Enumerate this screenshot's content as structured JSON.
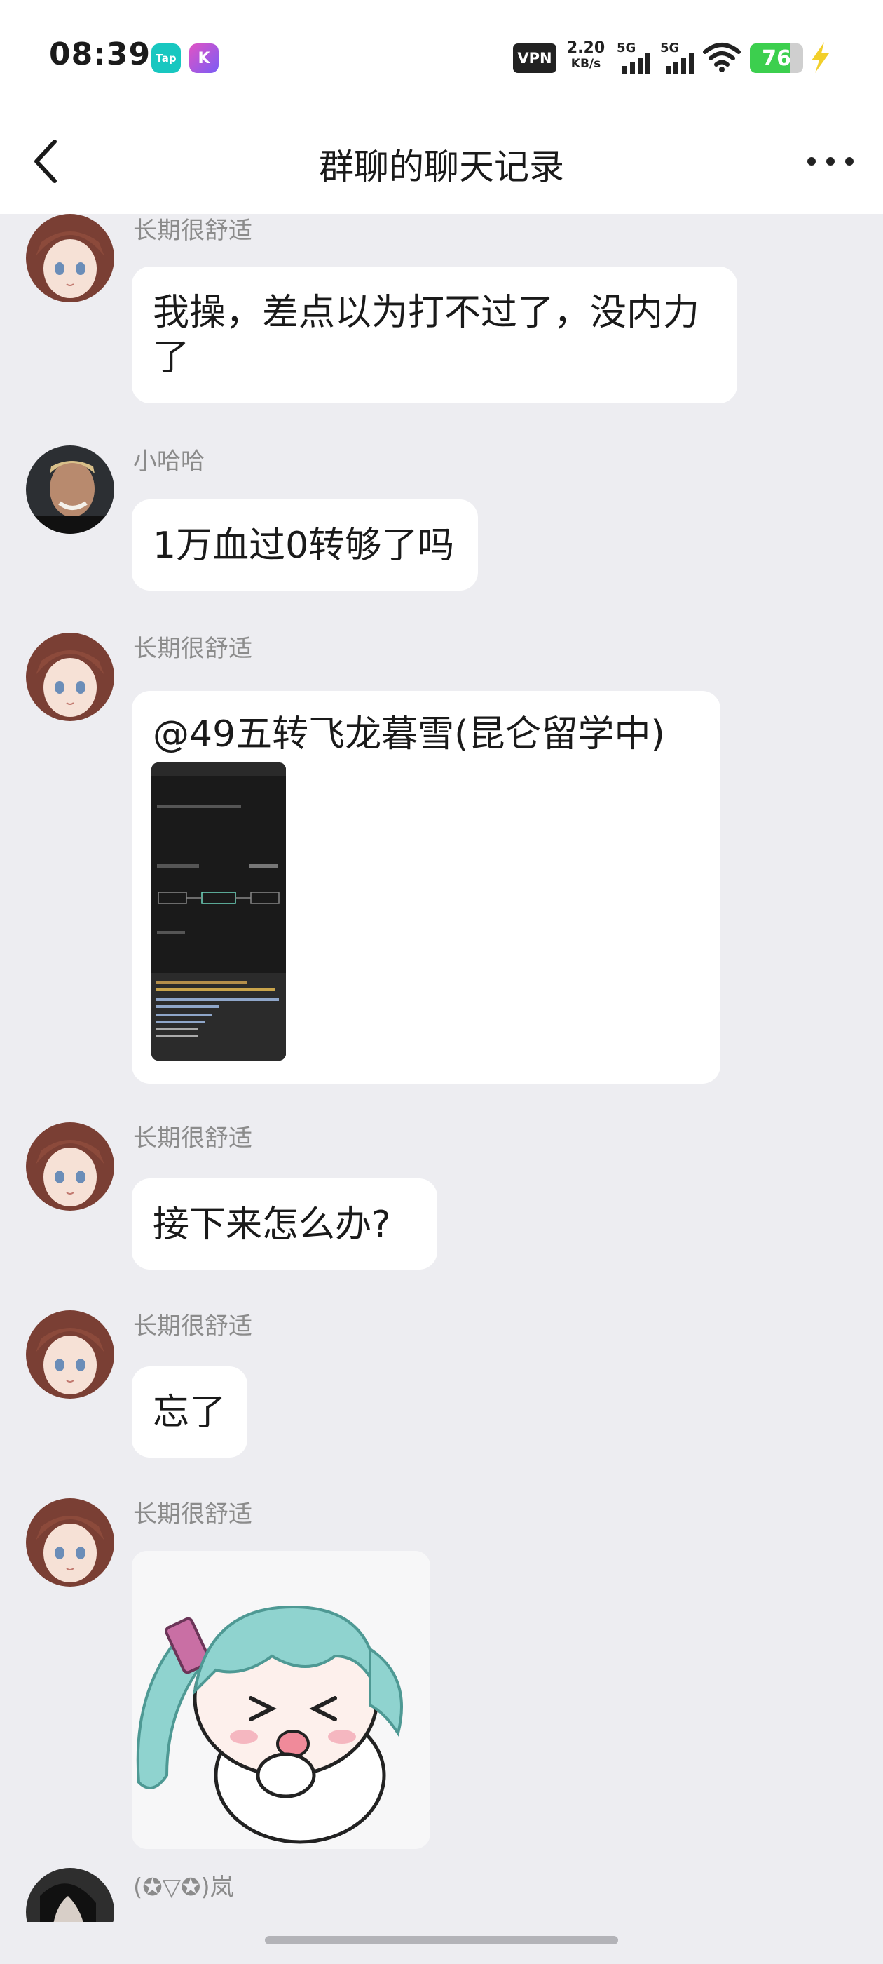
{
  "status_bar": {
    "time": "08:39",
    "app_badges": [
      {
        "icon": "taptap-icon",
        "label": "Tap"
      },
      {
        "icon": "k-app-icon",
        "label": "K"
      }
    ],
    "vpn": "VPN",
    "speed_value": "2.20",
    "speed_unit": "KB/s",
    "network_1": "5G",
    "network_2": "5G",
    "battery_level": 76,
    "battery_label": "76",
    "charging": true
  },
  "header": {
    "back_icon": "chevron-left-icon",
    "title": "群聊的聊天记录",
    "more_icon": "more-dots-icon"
  },
  "messages": [
    {
      "sender": "长期很舒适",
      "text": "我操，差点以为打不过了，没内力了"
    },
    {
      "sender": "小哈哈",
      "text": "1万血过0转够了吗"
    },
    {
      "sender": "长期很舒适",
      "text": "@49五转飞龙暮雪(昆仑留学中)"
    },
    {
      "sender": "长期很舒适",
      "text": "接下来怎么办?"
    },
    {
      "sender": "长期很舒适",
      "text": "忘了"
    },
    {
      "sender": "长期很舒适",
      "sticker": "anime-sticker-teal-hair"
    },
    {
      "sender": "(✪▽✪)岚"
    }
  ],
  "colors": {
    "background": "#ededf1",
    "bubble": "#ffffff",
    "sender_name": "#8b8b8b",
    "battery_fill": "#3ccf4e",
    "charging_bolt": "#f2cf2a"
  }
}
